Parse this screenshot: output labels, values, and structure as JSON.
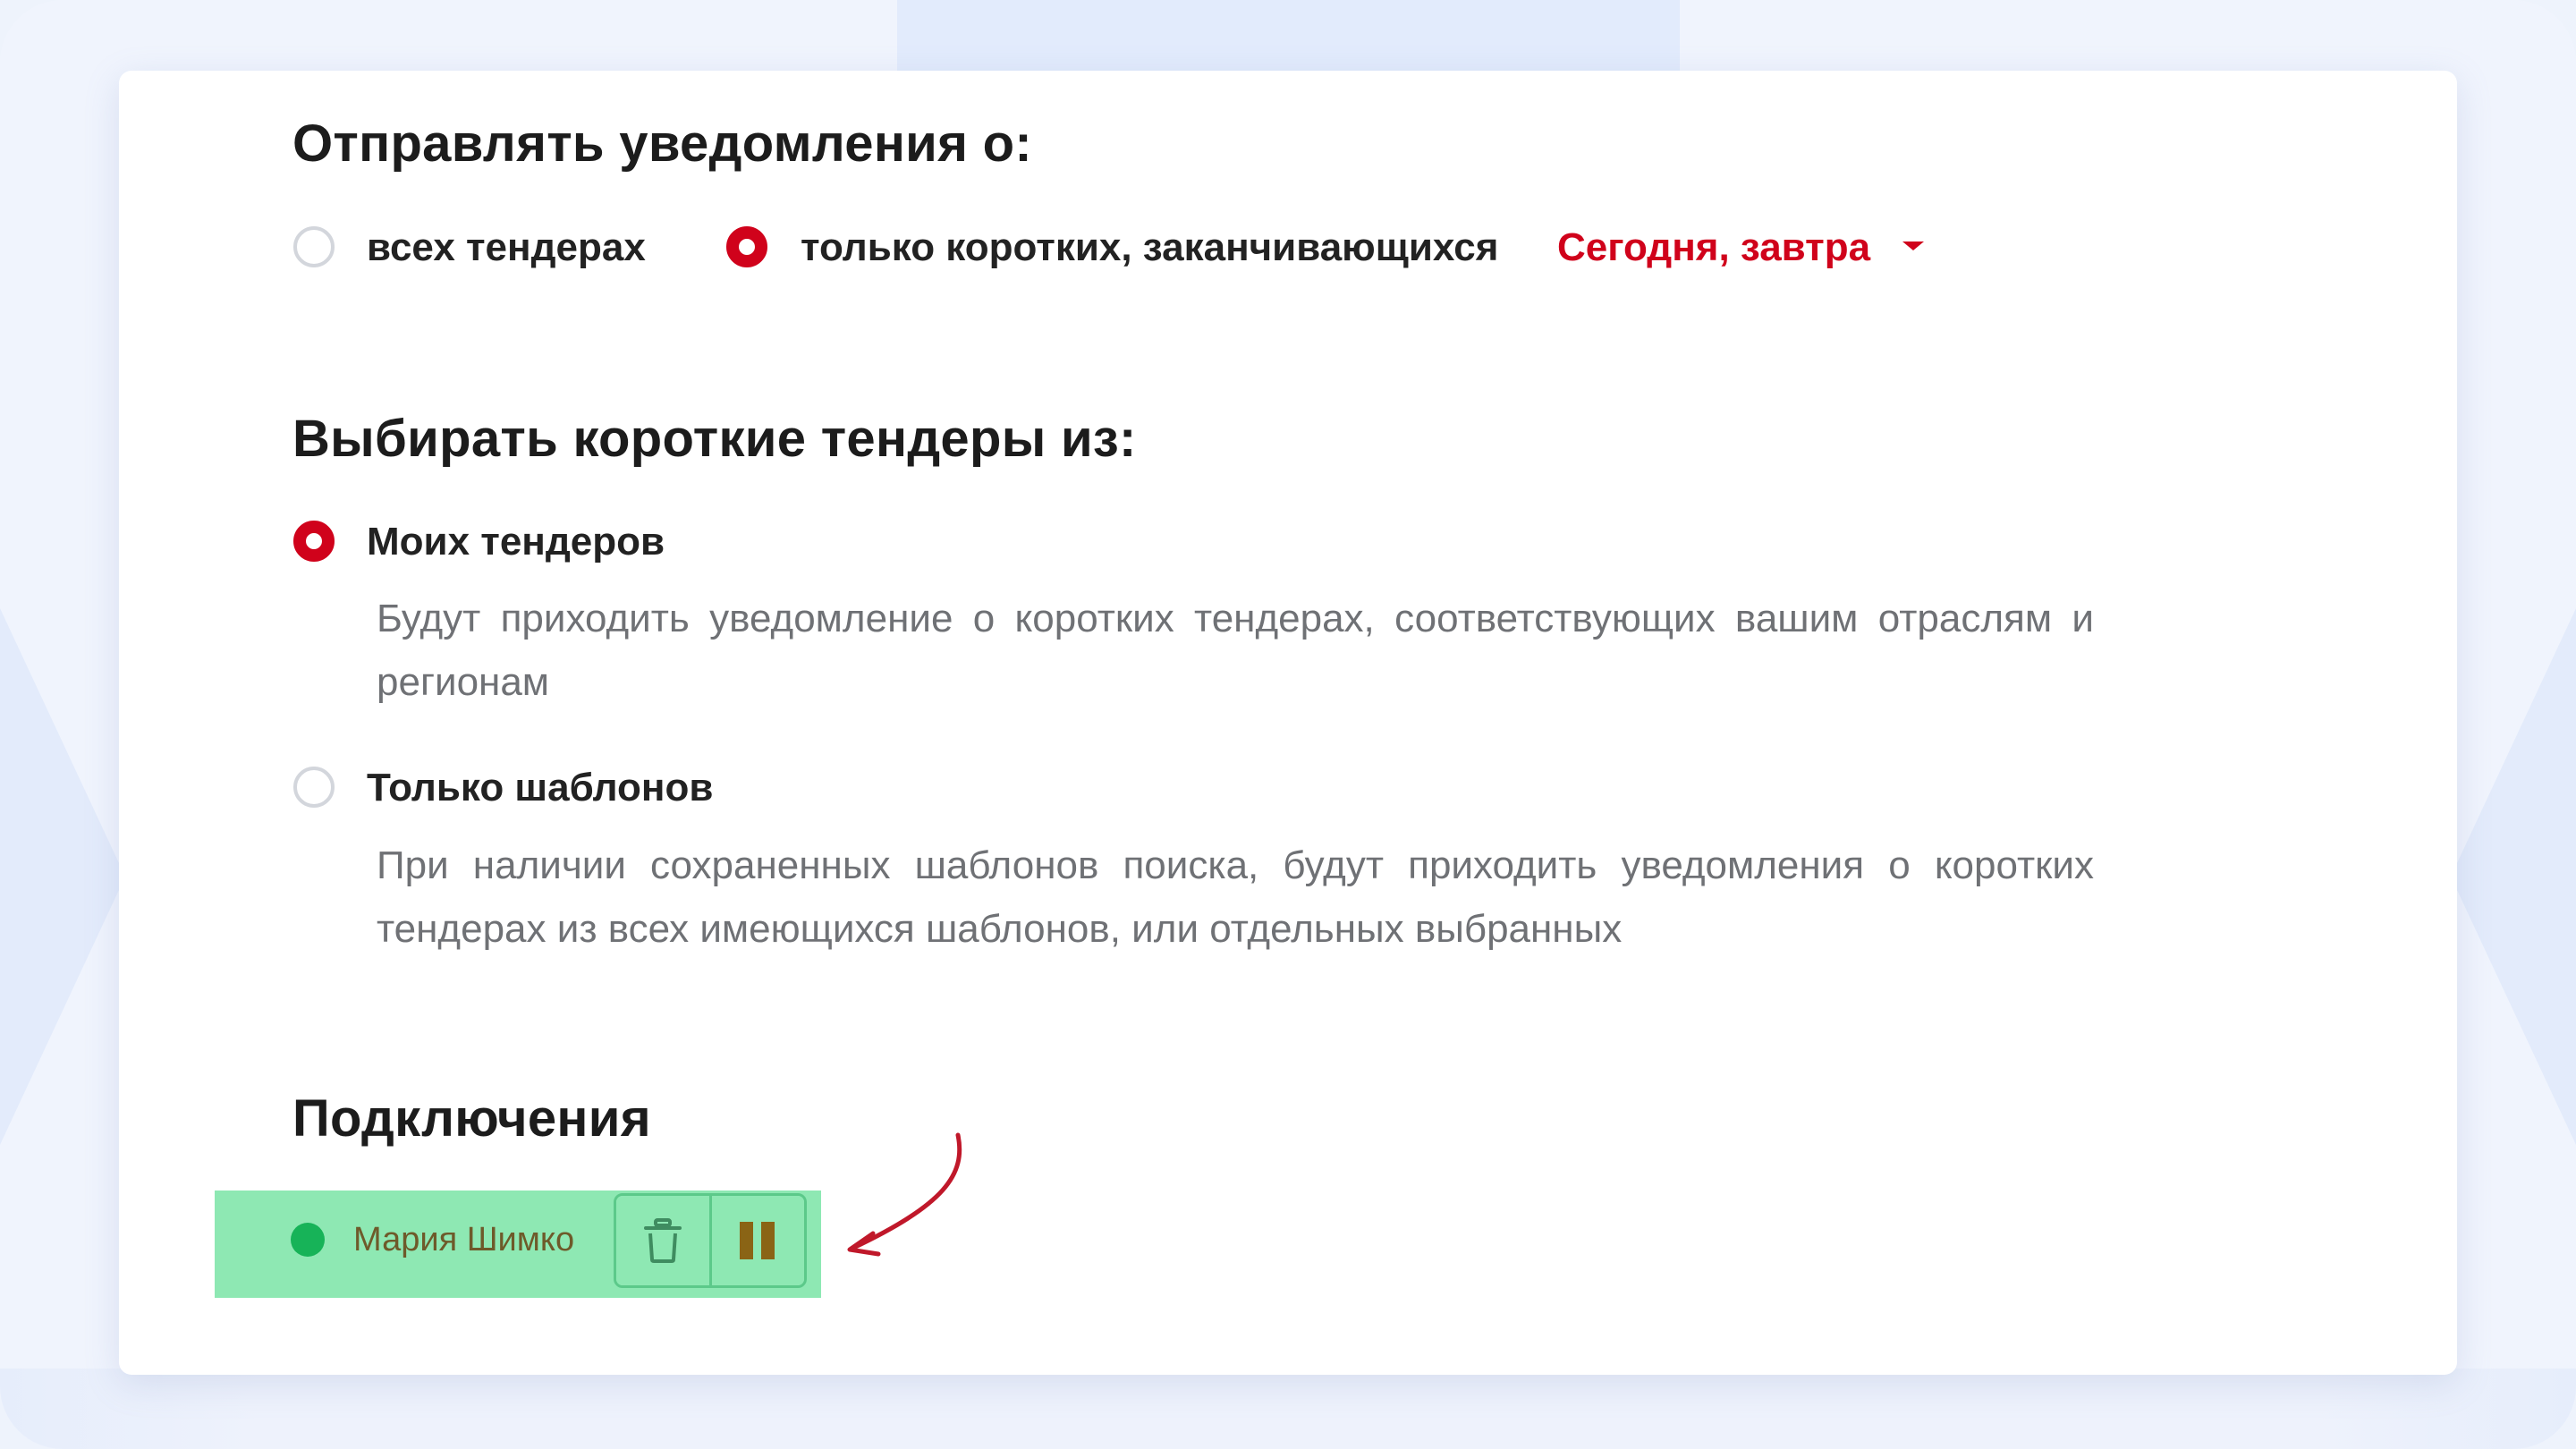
{
  "notify": {
    "heading": "Отправлять уведомления о:",
    "options": [
      {
        "label": "всех тендерах",
        "selected": false
      },
      {
        "label": "только коротких, заканчивающихся",
        "selected": true
      }
    ],
    "period_select": {
      "value": "Сегодня, завтра"
    }
  },
  "source": {
    "heading": "Выбирать короткие тендеры из:",
    "options": [
      {
        "label": "Моих тендеров",
        "selected": true,
        "description": "Будут приходить уведомление о коротких тендерах, соответствующих вашим отраслям и регионам"
      },
      {
        "label": "Только шаблонов",
        "selected": false,
        "description": "При наличии сохраненных шаблонов поиска, будут приходить уведомления о коротких тендерах из всех имеющихся шаблонов, или отдельных выбранных"
      }
    ]
  },
  "connections": {
    "heading": "Подключения",
    "items": [
      {
        "name": "Мария Шимко",
        "status": "active",
        "status_color": "#17b358"
      }
    ]
  },
  "colors": {
    "accent": "#d0021b",
    "connection_highlight": "#8ee8b3",
    "annotation_arrow": "#c0182a"
  },
  "icons": {
    "delete": "trash-icon",
    "pause": "pause-icon"
  }
}
